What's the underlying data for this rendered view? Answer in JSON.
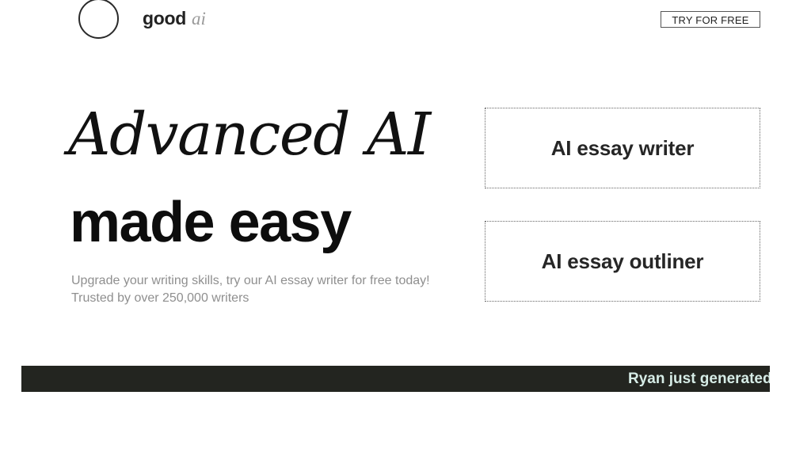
{
  "header": {
    "logo_word": "good",
    "logo_suffix": "ai",
    "cta_label": "TRY FOR FREE"
  },
  "hero": {
    "title_line1": "Advanced AI",
    "title_line2": "made easy",
    "subtitle_line1": "Upgrade your writing skills, try our AI essay writer for free today!",
    "subtitle_line2": "Trusted by over 250,000 writers"
  },
  "tools": [
    {
      "label": "AI essay writer"
    },
    {
      "label": "AI essay outliner"
    }
  ],
  "ticker": {
    "text": "Ryan just generated"
  },
  "colors": {
    "ticker_background": "#232520",
    "ticker_text": "#d6ece6",
    "subtitle_text": "#8f8f8f"
  }
}
